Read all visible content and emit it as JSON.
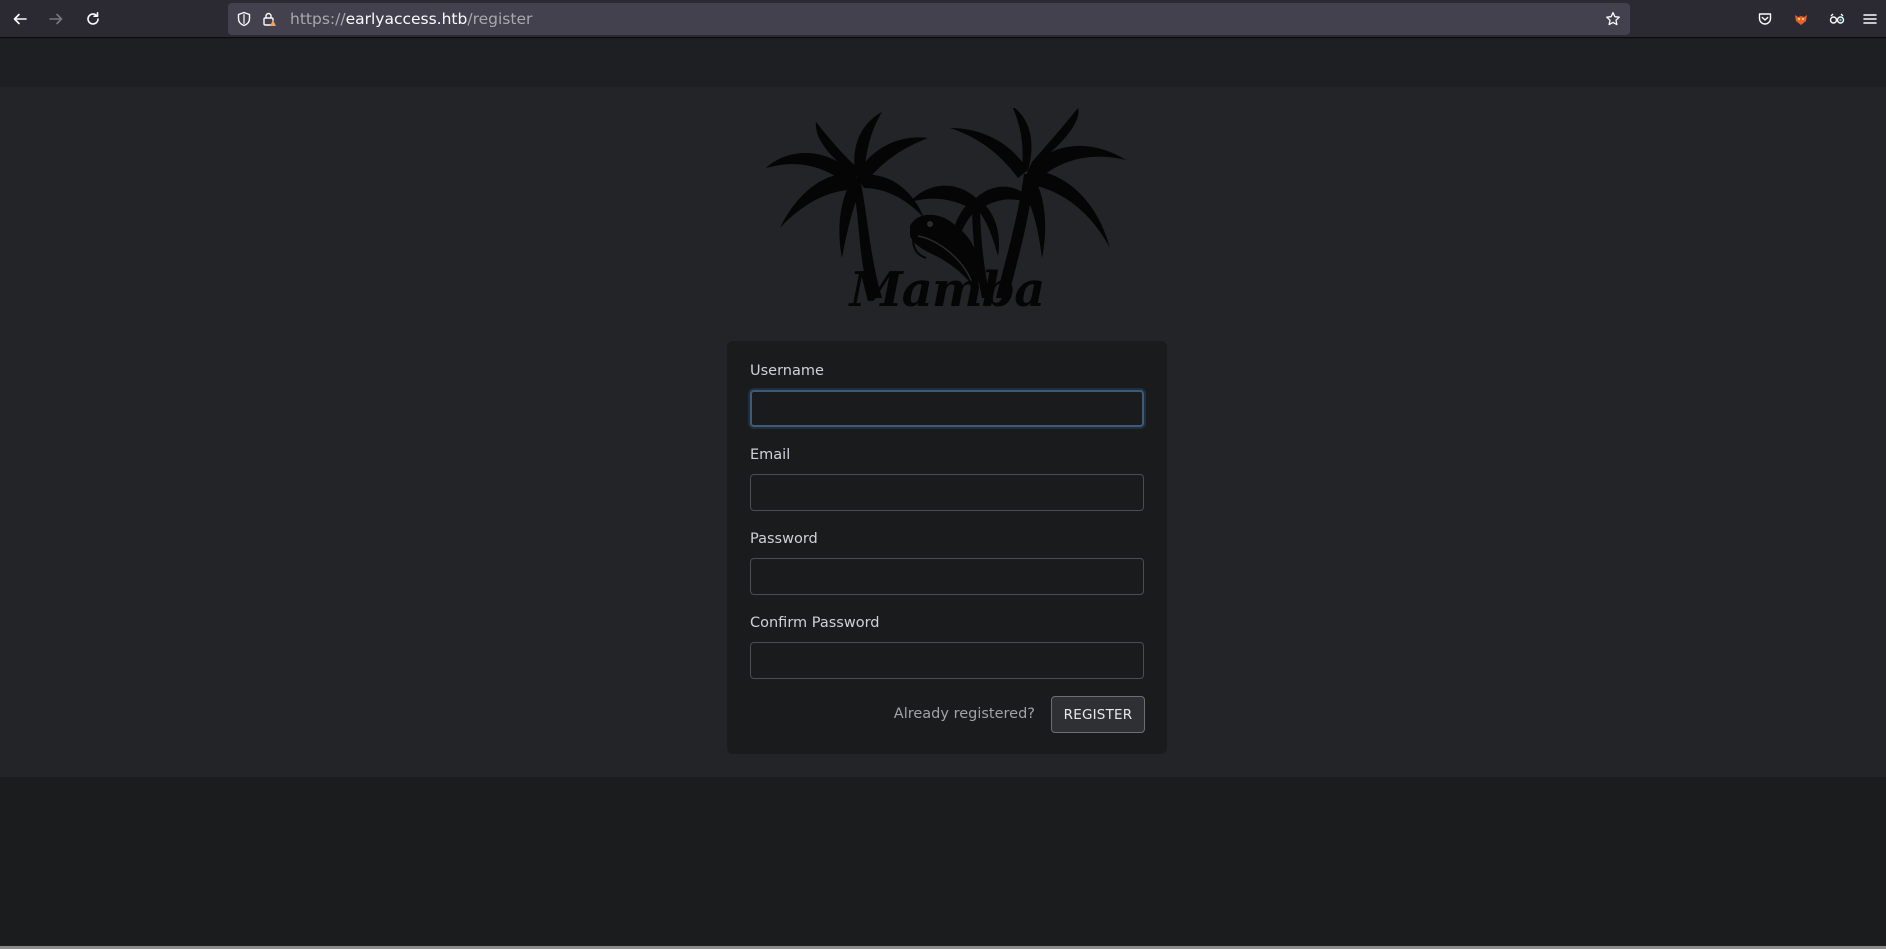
{
  "browser": {
    "url": {
      "scheme": "https://",
      "host": "earlyaccess.htb",
      "path": "/register"
    },
    "icons": {
      "back": "arrow-left-icon",
      "forward": "arrow-right-icon",
      "reload": "reload-icon",
      "tracking": "shield-icon",
      "security": "lock-warning-icon",
      "bookmark": "star-icon",
      "pocket": "pocket-icon",
      "extension1": "fox-extension-icon",
      "extension2": "glasses-extension-icon",
      "menu": "hamburger-menu-icon"
    }
  },
  "page": {
    "logo_text": "Mamba",
    "form": {
      "username_label": "Username",
      "username_value": "",
      "email_label": "Email",
      "email_value": "",
      "password_label": "Password",
      "password_value": "",
      "confirm_password_label": "Confirm Password",
      "confirm_password_value": "",
      "already_registered_link": "Already registered?",
      "register_button": "REGISTER"
    }
  },
  "colors": {
    "page_background": "#222427",
    "card_background": "#1a1b1d",
    "focus_border": "#3d5a78",
    "toolbar": "#2b2a33",
    "urlbar": "#42414d"
  }
}
